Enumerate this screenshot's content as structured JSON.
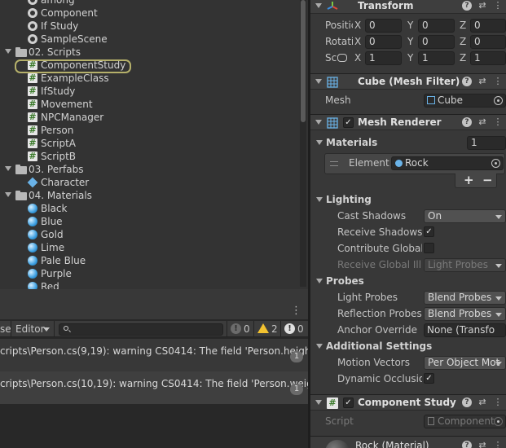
{
  "project": {
    "tree": [
      {
        "label": "among",
        "icon": "unity-scene-icon",
        "kind": "file",
        "indent": 34
      },
      {
        "label": "Component",
        "icon": "unity-scene-icon",
        "kind": "file",
        "indent": 34
      },
      {
        "label": "If Study",
        "icon": "unity-scene-icon",
        "kind": "file",
        "indent": 34
      },
      {
        "label": "SampleScene",
        "icon": "unity-scene-icon",
        "kind": "file",
        "indent": 34
      },
      {
        "label": "02. Scripts",
        "icon": "folder-icon",
        "kind": "folder",
        "indent": 6
      },
      {
        "label": "ComponentStudy",
        "icon": "script-icon",
        "kind": "file",
        "indent": 34,
        "selected": true
      },
      {
        "label": "ExampleClass",
        "icon": "script-icon",
        "kind": "file",
        "indent": 34
      },
      {
        "label": "IfStudy",
        "icon": "script-icon",
        "kind": "file",
        "indent": 34
      },
      {
        "label": "Movement",
        "icon": "script-icon",
        "kind": "file",
        "indent": 34
      },
      {
        "label": "NPCManager",
        "icon": "script-icon",
        "kind": "file",
        "indent": 34
      },
      {
        "label": "Person",
        "icon": "script-icon",
        "kind": "file",
        "indent": 34
      },
      {
        "label": "ScriptA",
        "icon": "script-icon",
        "kind": "file",
        "indent": 34
      },
      {
        "label": "ScriptB",
        "icon": "script-icon",
        "kind": "file",
        "indent": 34
      },
      {
        "label": "03. Perfabs",
        "icon": "folder-icon",
        "kind": "folder",
        "indent": 6
      },
      {
        "label": "Character",
        "icon": "prefab-icon",
        "kind": "file",
        "indent": 34
      },
      {
        "label": "04. Materials",
        "icon": "folder-icon",
        "kind": "folder",
        "indent": 6
      },
      {
        "label": "Black",
        "icon": "material-icon",
        "kind": "file",
        "indent": 34
      },
      {
        "label": "Blue",
        "icon": "material-icon",
        "kind": "file",
        "indent": 34
      },
      {
        "label": "Gold",
        "icon": "material-icon",
        "kind": "file",
        "indent": 34
      },
      {
        "label": "Lime",
        "icon": "material-icon",
        "kind": "file",
        "indent": 34
      },
      {
        "label": "Pale Blue",
        "icon": "material-icon",
        "kind": "file",
        "indent": 34
      },
      {
        "label": "Purple",
        "icon": "material-icon",
        "kind": "file",
        "indent": 34
      },
      {
        "label": "Red",
        "icon": "material-icon",
        "kind": "file",
        "indent": 34
      }
    ]
  },
  "console": {
    "toolbar": {
      "collapse_label": "se",
      "editor_label": "Editor",
      "search_placeholder": "",
      "info_count": "0",
      "warning_count": "2",
      "error_count": "0"
    },
    "logs": [
      {
        "text": "cripts\\Person.cs(9,19): warning CS0414: The field 'Person.height' is a",
        "count": "1"
      },
      {
        "text": "cripts\\Person.cs(10,19): warning CS0414: The field 'Person.weight' is",
        "count": "1"
      }
    ]
  },
  "inspector": {
    "transform": {
      "title": "Transform",
      "rows": [
        {
          "label": "Positic",
          "x": "0",
          "y": "0",
          "z": "0"
        },
        {
          "label": "Rotati",
          "x": "0",
          "y": "0",
          "z": "0"
        },
        {
          "label": "Sc",
          "x": "1",
          "y": "1",
          "z": "1"
        }
      ],
      "axes": [
        "X",
        "Y",
        "Z"
      ]
    },
    "mesh_filter": {
      "title": "Cube (Mesh Filter)",
      "mesh_label": "Mesh",
      "mesh_value": "Cube"
    },
    "mesh_renderer": {
      "title": "Mesh Renderer",
      "enabled": true,
      "materials_label": "Materials",
      "materials_count": "1",
      "element_label": "Element",
      "element_value": "Rock",
      "lighting_label": "Lighting",
      "cast_shadows_label": "Cast Shadows",
      "cast_shadows_value": "On",
      "receive_shadows_label": "Receive Shadows",
      "receive_shadows": true,
      "contribute_gi_label": "Contribute Global I",
      "contribute_gi": false,
      "receive_gi_label": "Receive Global Illu",
      "receive_gi_value": "Light Probes",
      "probes_label": "Probes",
      "light_probes_label": "Light Probes",
      "light_probes_value": "Blend Probes",
      "reflection_probes_label": "Reflection Probes",
      "reflection_probes_value": "Blend Probes",
      "anchor_override_label": "Anchor Override",
      "anchor_override_value": "None (Transfo",
      "additional_label": "Additional Settings",
      "motion_vectors_label": "Motion Vectors",
      "motion_vectors_value": "Per Object Mot",
      "dynamic_occlusion_label": "Dynamic Occlusio",
      "dynamic_occlusion": true
    },
    "component_study": {
      "title": "Component Study (S",
      "enabled": true,
      "script_label": "Script",
      "script_value": "Component"
    },
    "material_preview": {
      "title": "Rock (Material)"
    }
  },
  "colors": {
    "selection_ring": "#b5b06a",
    "warning": "#f2c230",
    "material_blue": "#3a9ee0"
  }
}
